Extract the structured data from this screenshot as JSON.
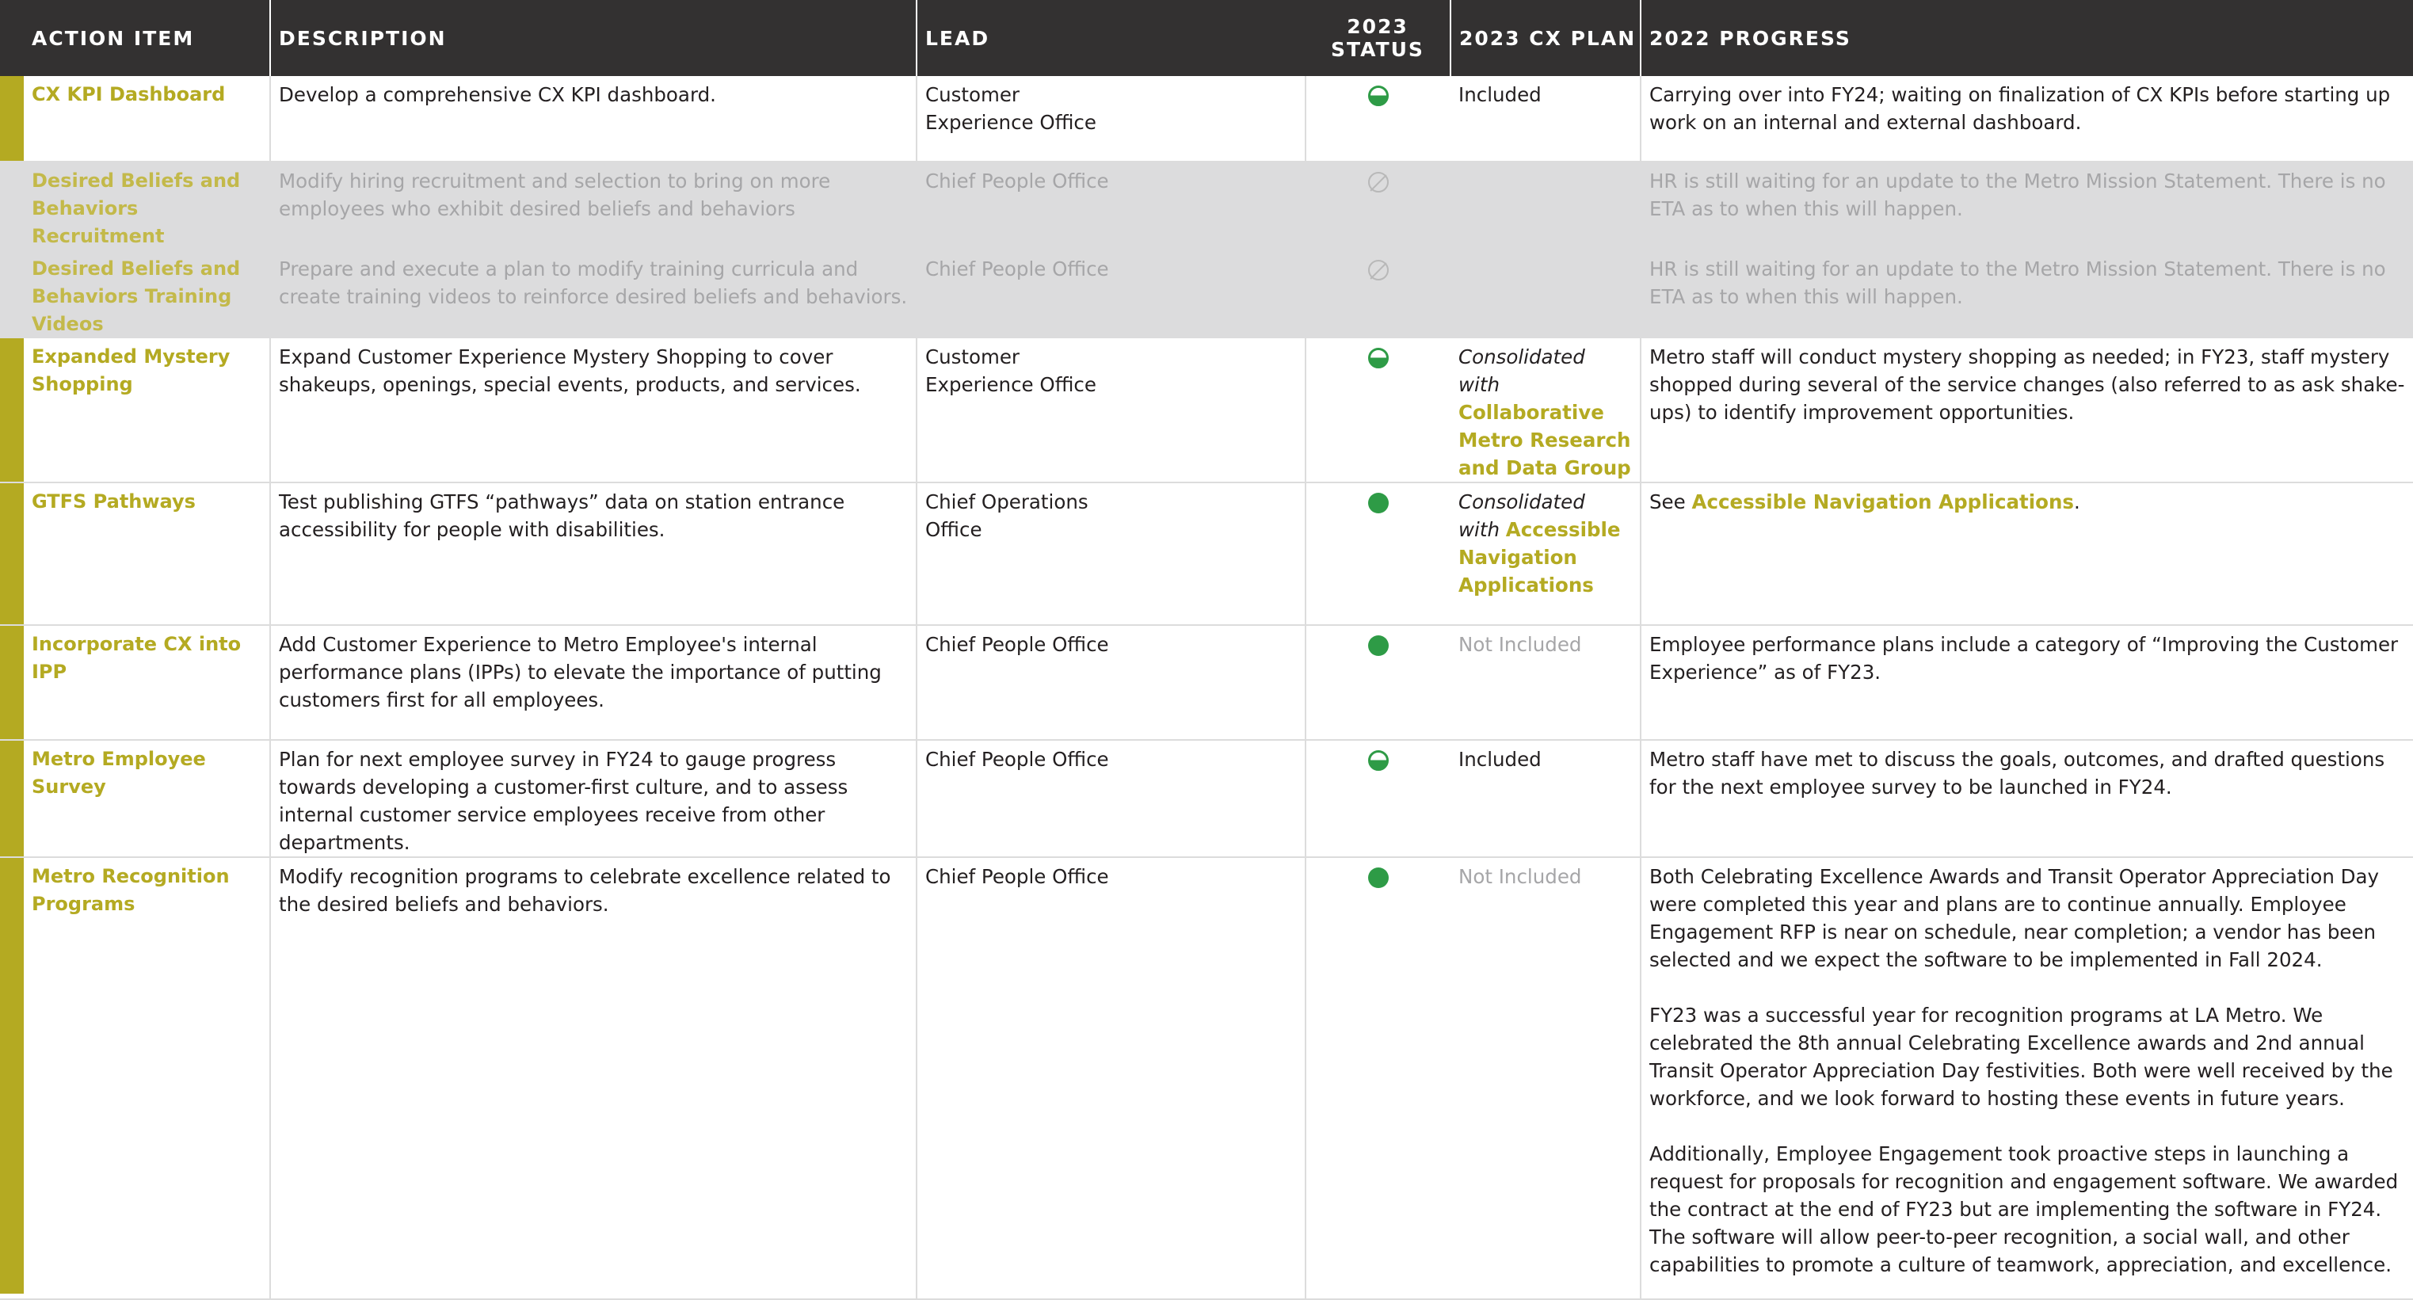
{
  "headers": {
    "action_item": "ACTION ITEM",
    "description": "DESCRIPTION",
    "lead": "LEAD",
    "status": "2023 STATUS",
    "plan": "2023 CX PLAN",
    "progress": "2022 PROGRESS"
  },
  "colors": {
    "header_bg": "#333131",
    "accent_olive": "#b4aa22",
    "status_green": "#2e9b46",
    "muted_row_bg": "#dcdcdd"
  },
  "status_legend": {
    "half": "half-filled-circle-icon",
    "full": "filled-circle-icon",
    "na": "not-applicable-icon"
  },
  "rows": [
    {
      "item": "CX KPI Dashboard",
      "description": "Develop a comprehensive CX KPI dashboard.",
      "lead": "Customer Experience Office",
      "status": "half",
      "plan": "Included",
      "progress": [
        "Carrying over into FY24; waiting on finalization of CX KPIs before starting up work on an internal and external dashboard."
      ]
    },
    {
      "item": "Desired Beliefs and Behaviors Recruitment",
      "description": "Modify hiring recruitment and selection to bring on more employees who exhibit desired beliefs and behaviors",
      "lead": "Chief People Office",
      "status": "na",
      "plan": "",
      "progress": [
        "HR is still waiting for an update to the Metro Mission Statement. There is no ETA as to when this will happen."
      ]
    },
    {
      "item": "Desired Beliefs and Behaviors Training Videos",
      "description": "Prepare and execute a plan to modify training curricula and create training videos to reinforce desired beliefs and behaviors.",
      "lead": "Chief People Office",
      "status": "na",
      "plan": "",
      "progress": [
        "HR is still waiting for an update to the Metro Mission Statement. There is no ETA as to when this will happen."
      ]
    },
    {
      "item": "Expanded Mystery Shopping",
      "description": "Expand Customer Experience Mystery Shopping to cover shakeups, openings, special events, products, and services.",
      "lead": "Customer Experience Office",
      "status": "half",
      "plan_prefix": "Consolidated with",
      "plan_link": "Collaborative Metro Research and Data Group",
      "progress": [
        "Metro staff will conduct mystery shopping as needed; in FY23, staff mystery shopped during several of the service changes (also referred to as​​​​​​​​​​​​​​​​​​​​​​​​​​​​​​​​​​​​​​​​​​​​​​​​​​​​​​​​​​​​​​​​​​​​​​​​​​​​​​​​​​​​​​​​​​​​​​​​​​​​​​​​​​​​​​ ask shake-ups) to identify improvement opportunities."
      ]
    },
    {
      "item": "GTFS Pathways",
      "description": "Test publishing GTFS “pathways” data on station entrance accessibility for people with disabilities.",
      "lead": "Chief Operations Office",
      "status": "full",
      "plan_prefix": "Consolidated with",
      "plan_link": "Accessible Navigation Applications",
      "progress_prefix": "See",
      "progress_link": "Accessible Navigation Applications",
      "progress_suffix": "."
    },
    {
      "item": "Incorporate CX into IPP",
      "description": "Add Customer Experience to Metro Employee's internal performance plans (IPPs) to elevate the importance of putting customers first for all employees.",
      "lead": "Chief People Office",
      "status": "full",
      "plan": "Not Included",
      "progress": [
        "Employee performance plans include a category of “Improving the Customer Experience” as of FY23."
      ]
    },
    {
      "item": "Metro Employee Survey",
      "description": "Plan for next employee survey in FY24 to gauge progress towards developing a customer-first culture, and to assess internal customer service employees receive from other departments.",
      "lead": "Chief People Office",
      "status": "half",
      "plan": "Included",
      "progress": [
        "Metro staff have met to discuss the goals, outcomes, and drafted questions for the next employee survey to be launched in FY24."
      ]
    },
    {
      "item": "Metro Recognition Programs",
      "description": "Modify recognition programs to celebrate excellence related to the desired beliefs and behaviors.",
      "lead": "Chief People Office",
      "status": "full",
      "plan": "Not Included",
      "progress": [
        "Both Celebrating Excellence Awards and Transit Operator Appreciation Day were completed this year and plans are to continue annually. Employee Engagement RFP is near on schedule, near completion; a vendor has been selected and we expect the software to be implemented in Fall 2024.",
        "FY23 was a successful year for recognition programs at LA Metro. We celebrated the 8th annual Celebrating Excellence awards and 2nd annual Transit Operator Appreciation Day festivities. Both were well received by the workforce, and we look forward to hosting these events in future years.",
        "Additionally, Employee Engagement took proactive steps in launching a request for proposals for recognition and engagement software. We awarded the contract at the end of FY23 but are implementing the software in FY24. The software will allow peer-to-peer recognition, a social wall, and other capabilities to promote a culture of teamwork, appreciation, and excellence."
      ]
    }
  ]
}
